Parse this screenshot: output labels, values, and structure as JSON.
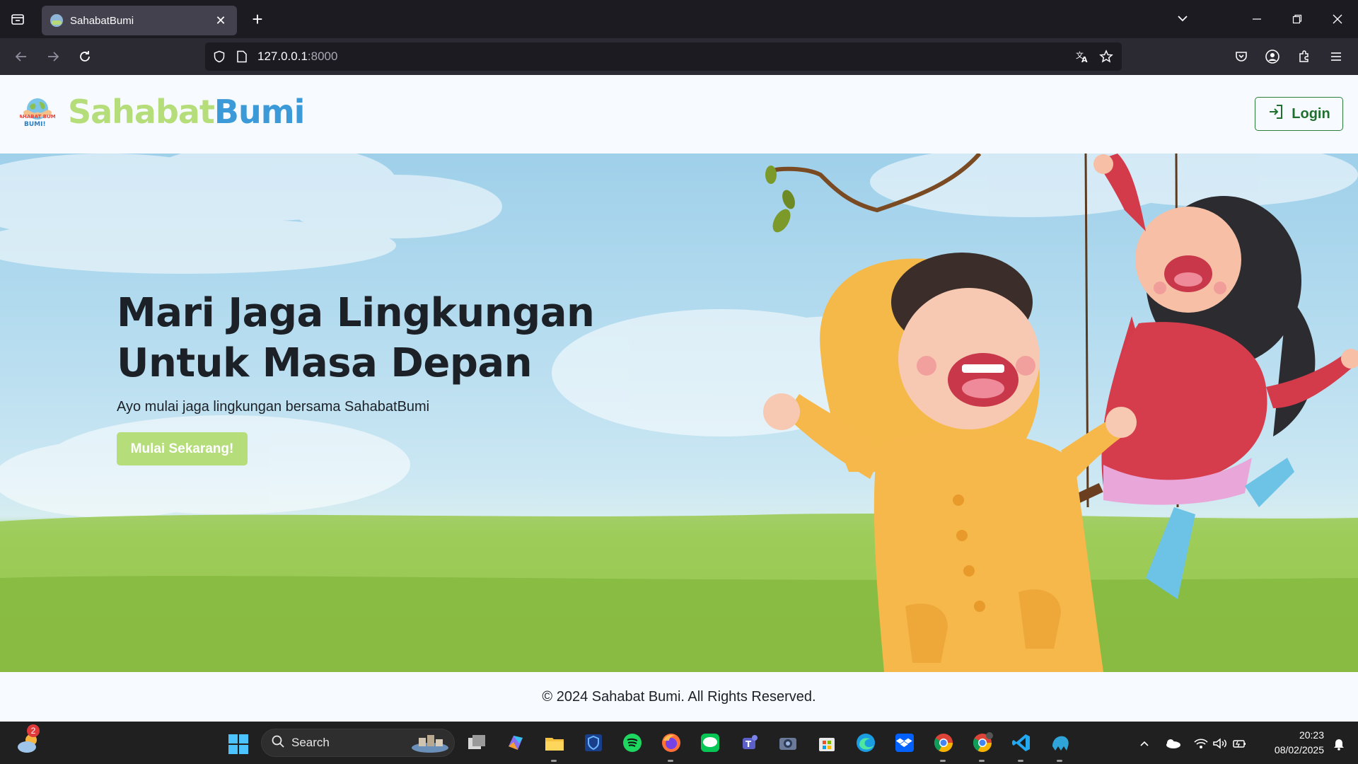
{
  "browser": {
    "tab_title": "SahabatBumi",
    "url_host": "127.0.0.1",
    "url_port": ":8000"
  },
  "site": {
    "brand_part1": "Sahabat",
    "brand_part2": "Bumi",
    "logo_text": "SAHABAT BUMI!",
    "login_label": "Login"
  },
  "hero": {
    "title_line1": "Mari Jaga Lingkungan",
    "title_line2": "Untuk Masa Depan",
    "subtitle": "Ayo mulai jaga lingkungan bersama SahabatBumi",
    "cta_label": "Mulai Sekarang!"
  },
  "footer": {
    "copyright": "© 2024 Sahabat Bumi. All Rights Reserved."
  },
  "taskbar": {
    "weather_badge": "2",
    "search_label": "Search",
    "time": "20:23",
    "date": "08/02/2025",
    "apps": [
      "task-view",
      "copilot",
      "file-explorer",
      "defender",
      "spotify",
      "firefox",
      "line",
      "teams",
      "camera",
      "microsoft-store",
      "edge",
      "dropbox",
      "chrome",
      "chrome-profile",
      "vscode",
      "mysql-workbench"
    ]
  },
  "colors": {
    "brand_green": "#b5dd7a",
    "brand_blue": "#3d9ad8",
    "login_green": "#2b7d3a",
    "text_dark": "#1c2128"
  }
}
